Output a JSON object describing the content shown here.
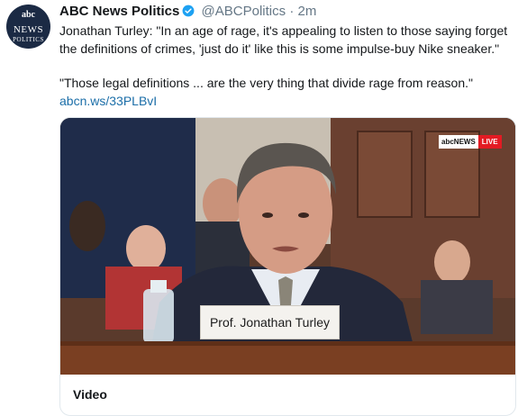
{
  "account": {
    "avatar_abc": "abc",
    "avatar_line1": "NEWS",
    "avatar_line2": "POLITICS",
    "name": "ABC News Politics",
    "handle": "@ABCPolitics",
    "separator": "·",
    "time": "2m"
  },
  "tweet": {
    "paragraph1": "Jonathan Turley: \"In an age of rage, it's appealing to listen to those saying forget the definitions of crimes, 'just do it' like this is some impulse-buy Nike sneaker.\"",
    "paragraph2": "\"Those legal definitions ... are the very thing that divide rage from reason.\"",
    "link": "abcn.ws/33PLBvI"
  },
  "media": {
    "nameplate": "Prof. Jonathan Turley",
    "bug_brand": "abcNEWS",
    "bug_live": "LIVE",
    "card_label": "Video"
  },
  "colors": {
    "verified": "#1da1f2",
    "link": "#1b6ea8",
    "live": "#e31b23"
  }
}
